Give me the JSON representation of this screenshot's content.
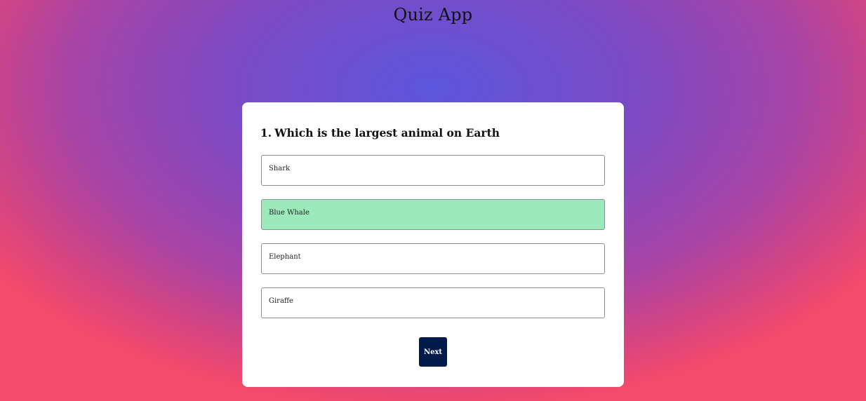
{
  "app": {
    "title": "Quiz App"
  },
  "quiz": {
    "question_number": "1.",
    "question_text": "Which is the largest animal on Earth",
    "answers": [
      {
        "label": "Shark",
        "state": "default"
      },
      {
        "label": "Blue Whale",
        "state": "correct"
      },
      {
        "label": "Elephant",
        "state": "default"
      },
      {
        "label": "Giraffe",
        "state": "default"
      }
    ],
    "next_label": "Next"
  },
  "colors": {
    "card_background": "#ffffff",
    "correct_answer": "#9ceabc",
    "next_button": "#001b4a",
    "gradient_center": "#5b56dc",
    "gradient_edge": "#f44a6b"
  }
}
